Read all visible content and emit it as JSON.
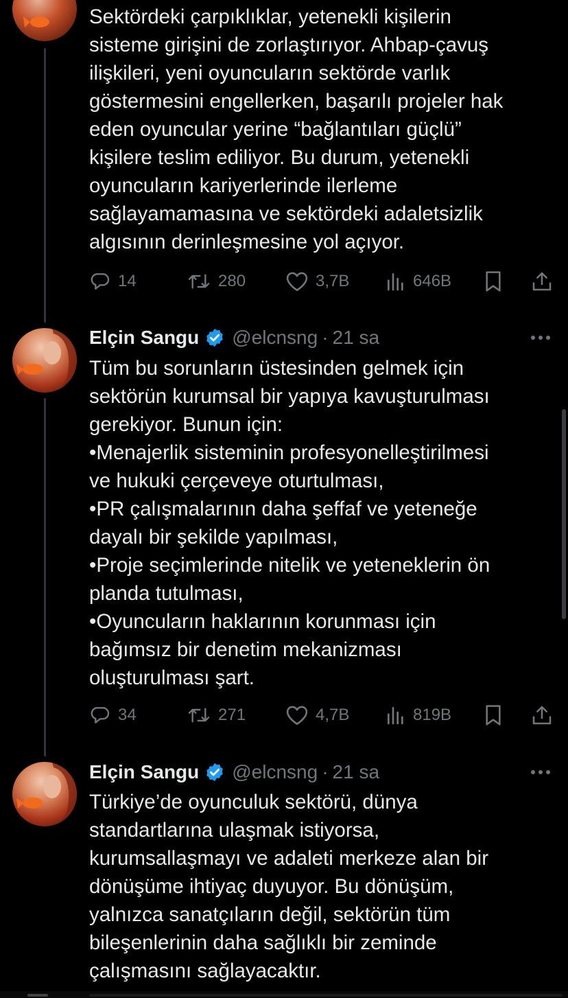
{
  "tweets": [
    {
      "text": "Sektördeki çarpıklıklar, yetenekli kişilerin\nsisteme girişini de zorlaştırıyor. Ahbap-çavuş\nilişkileri, yeni oyuncuların sektörde varlık\ngöstermesini engellerken, başarılı projeler hak\neden oyuncular yerine “bağlantıları güçlü”\nkişilere teslim ediliyor. Bu durum, yetenekli\noyuncuların kariyerlerinde ilerleme\nsağlayamamasına ve sektördeki adaletsizlik\nalgısının derinleşmesine yol açıyor.",
      "replies": "14",
      "retweets": "280",
      "likes": "3,7B",
      "views": "646B"
    },
    {
      "display_name": "Elçin Sangu",
      "handle": "@elcnsng",
      "separator": "·",
      "time": "21 sa",
      "text": "Tüm bu sorunların üstesinden gelmek için\nsektörün kurumsal bir yapıya kavuşturulması\ngerekiyor. Bunun için:\n•Menajerlik sisteminin profesyonelleştirilmesi\nve hukuki çerçeveye oturtulması,\n•PR çalışmalarının daha şeffaf ve yeteneğe\ndayalı bir şekilde yapılması,\n•Proje seçimlerinde nitelik ve yeteneklerin ön\nplanda tutulması,\n•Oyuncuların haklarının korunması için\nbağımsız bir denetim mekanizması\noluşturulması şart.",
      "replies": "34",
      "retweets": "271",
      "likes": "4,7B",
      "views": "819B"
    },
    {
      "display_name": "Elçin Sangu",
      "handle": "@elcnsng",
      "separator": "·",
      "time": "21 sa",
      "text": "Türkiye’de oyunculuk sektörü, dünya\nstandartlarına ulaşmak istiyorsa,\nkurumsallaşmayı ve adaleti merkeze alan bir\ndönüşüme ihtiyaç duyuyor. Bu dönüşüm,\nyalnızca sanatçıların değil, sektörün tüm\nbileşenlerinin daha sağlıklı bir zeminde\nçalışmasını sağlayacaktır."
    }
  ],
  "icons": {
    "reply": "reply-icon",
    "retweet": "retweet-icon",
    "like": "heart-icon",
    "views": "views-icon",
    "bookmark": "bookmark-icon",
    "share": "share-icon",
    "verified": "verified-badge-icon",
    "more": "more-icon"
  },
  "colors": {
    "background": "#000000",
    "text": "#e7e9ea",
    "secondary": "#71767b",
    "verified": "#1d9bf0",
    "thread_line": "#333639"
  }
}
